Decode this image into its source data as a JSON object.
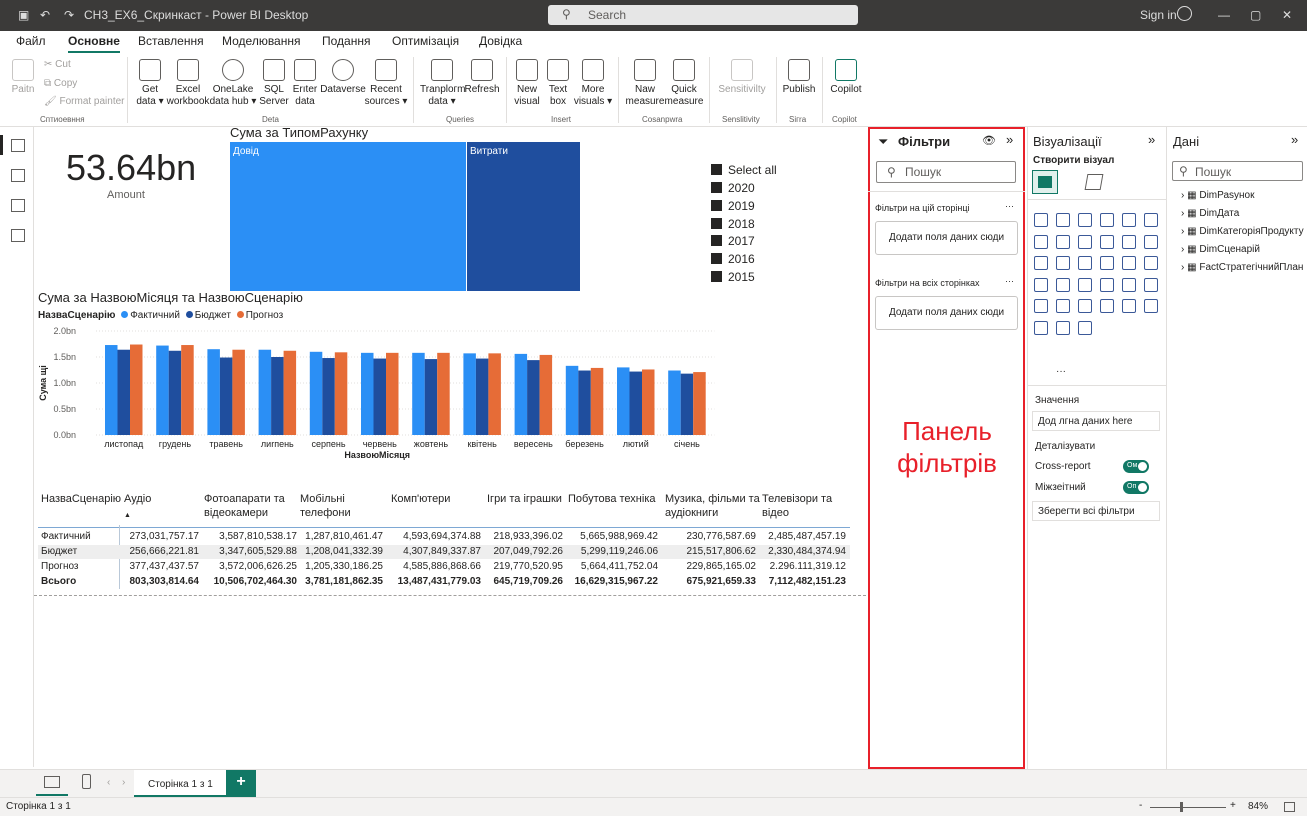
{
  "window": {
    "title": "СН3_ЕХ6_Скринкаст - Power BI Desktop",
    "search": "Search",
    "signin": "Sign in"
  },
  "menu": [
    "Файл",
    "Основне",
    "Вставлення",
    "Моделювання",
    "Подання",
    "Оптимізація",
    "Довідка"
  ],
  "ribbon": {
    "clipboard": {
      "paste": "Paitn",
      "cut": "Cut",
      "copy": "Copy",
      "format_painter": "Format painter",
      "group": "Сптиоевння"
    },
    "data": {
      "get_data": "Get data ▾",
      "excel": "Excel workbook",
      "onelake": "OneLake data hub ▾",
      "sql": "SQL Server",
      "enter": "Erıter data",
      "dataverse": "Dataverse",
      "recent": "Recent sources ▾",
      "group": "Deta"
    },
    "queries": {
      "transform": "Tranploгm data ▾",
      "refresh": "Refresh",
      "group": "Queries"
    },
    "insert": {
      "new_visual": "New visual",
      "text_box": "Text box",
      "more_visuals": "More visuals ▾",
      "group": "Insert"
    },
    "calc": {
      "new_measure": "Naw measure",
      "quick_measure": "Quick measure",
      "group": "Cosanpwra"
    },
    "sensitivity": {
      "label": "Sensitivilty",
      "group": "Senslitivity"
    },
    "share": {
      "publish": "Publish",
      "group": "Siгra"
    },
    "copilot": {
      "label": "Copilot",
      "group": "Copilot"
    }
  },
  "kpi": {
    "value": "53.64bn",
    "label": "Amount"
  },
  "treemap": {
    "title": "Сума за ТипомРахунку",
    "tiles": [
      "Довід",
      "Витрати"
    ],
    "colors": [
      "#2b8ff5",
      "#1f4e9e"
    ]
  },
  "slicer": {
    "items": [
      "Select all",
      "2020",
      "2019",
      "2018",
      "2017",
      "2016",
      "2015"
    ]
  },
  "chart_data": {
    "type": "bar",
    "title": "Сума за НазвоюМісяця та НазвоюСценарію",
    "legend_title": "НазваСценарію",
    "xlabel": "НазвоюМісяця",
    "ylabel": "Сума щі",
    "yticks": [
      "2.0bn",
      "1.5bn",
      "1.0bn",
      "0.5bn",
      "0.0bn"
    ],
    "ylim": [
      0,
      2.0
    ],
    "grid": true,
    "legend": "top-left",
    "categories": [
      "листопад",
      "грудень",
      "травень",
      "лиrпень",
      "серпень",
      "червень",
      "жовтень",
      "квітень",
      "вересень",
      "березень",
      "лютий",
      "січень"
    ],
    "series": [
      {
        "name": "Фактичний",
        "color": "#2b8ff5",
        "values": [
          1.73,
          1.72,
          1.65,
          1.64,
          1.6,
          1.58,
          1.58,
          1.57,
          1.56,
          1.33,
          1.3,
          1.24
        ]
      },
      {
        "name": "Бюджет",
        "color": "#1f4e9e",
        "values": [
          1.64,
          1.62,
          1.49,
          1.5,
          1.48,
          1.47,
          1.46,
          1.47,
          1.44,
          1.24,
          1.22,
          1.18
        ]
      },
      {
        "name": "Прогноз",
        "color": "#e66c37",
        "values": [
          1.74,
          1.73,
          1.64,
          1.62,
          1.59,
          1.58,
          1.58,
          1.57,
          1.54,
          1.29,
          1.26,
          1.21
        ]
      }
    ]
  },
  "table": {
    "headers": [
      "НазваСценарію",
      "Аудіо",
      "Фотоапарати та відеокамери",
      "Мобільні телефони",
      "Комп'ютери",
      "Ігри та іграшки",
      "Побутова техніка",
      "Музика, фільми та аудіокниги",
      "Телевізори та відео"
    ],
    "rows": [
      {
        "label": "Фактичний",
        "values": [
          "273,031,757.17",
          "3,587,810,538.17",
          "1,287,810,461.47",
          "4,593,694,374.88",
          "218,933,396.02",
          "5,665,988,969.42",
          "230,776,587.69",
          "2,485,487,457.19"
        ]
      },
      {
        "label": "Бюджет",
        "values": [
          "256,666,221.81",
          "3,347,605,529.88",
          "1,208,041,332.39",
          "4,307,849,337.87",
          "207,049,792.26",
          "5,299,119,246.06",
          "215,517,806.62",
          "2,330,484,374.94"
        ]
      },
      {
        "label": "Прогноз",
        "values": [
          "377,437,437.57",
          "3,572,006,626.25",
          "1,205,330,186.25",
          "4,585,886,868.66",
          "219,770,520.95",
          "5,664,411,752.04",
          "229,865,165.02",
          "2.296.111,319.12"
        ]
      },
      {
        "label": "Всього",
        "values": [
          "803,303,814.64",
          "10,506,702,464.30",
          "3,781,181,862.35",
          "13,487,431,779.03",
          "645,719,709.26",
          "16,629,315,967.22",
          "675,921,659.33",
          "7,112,482,151.23"
        ]
      }
    ]
  },
  "filters": {
    "title": "Фільтри",
    "search": "Пошук",
    "page_section": "Фільтри на цій сторінці",
    "add1": "Додати поля даних сюди",
    "all_section": "Фільтри на всіх сторінках",
    "add2": "Додати поля даних сюди",
    "annotation": "Панель фільтрів",
    "annotation_color": "#e8202a"
  },
  "viz": {
    "title": "Візуалізації",
    "build": "Створити візуал",
    "values": "Значення",
    "values_placeholder": "Дод лгна даних here",
    "drill": "Деталізувати",
    "cross": "Cross-report",
    "cross_toggle": "Ом",
    "keep": "Міжзеітний",
    "keep_toggle": "Оп",
    "keep_all": "Зберегти всі фільтри",
    "more": "···"
  },
  "data_pane": {
    "title": "Дані",
    "search": "Пошук",
    "fields": [
      "DimРаsунок",
      "DimДата",
      "DimКатегоріяПродукту",
      "DimСценарій",
      "FactСтратегічнийПлан"
    ]
  },
  "pages": {
    "current": "Сторінка 1 з 1",
    "add": "+"
  },
  "status": {
    "page": "Сторінка 1 з 1",
    "zoom": "84%",
    "minus": "-",
    "plus": "+"
  }
}
